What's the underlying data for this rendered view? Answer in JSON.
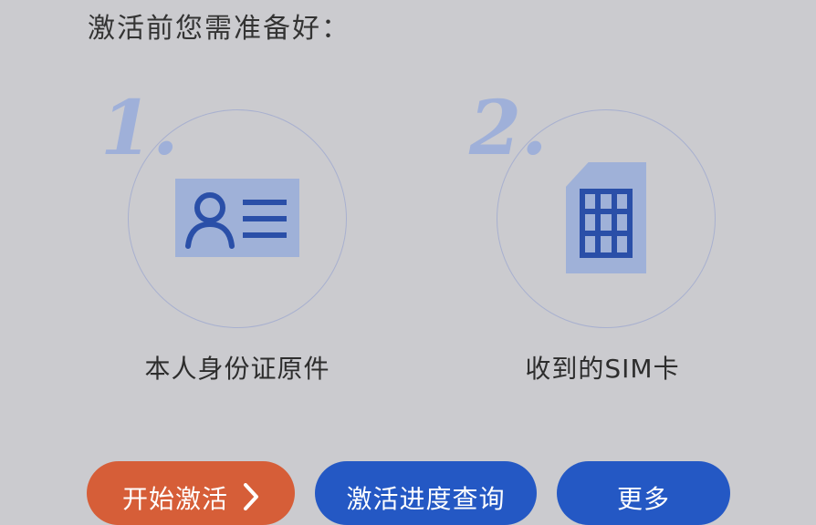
{
  "header": {
    "title": "激活前您需准备好："
  },
  "steps": [
    {
      "number": "1.",
      "label": "本人身份证原件",
      "icon": "id-card-icon"
    },
    {
      "number": "2.",
      "label": "收到的SIM卡",
      "icon": "sim-card-icon"
    }
  ],
  "buttons": {
    "start_label": "开始激活",
    "progress_label": "激活进度查询",
    "more_label": "更多"
  },
  "colors": {
    "background": "#cbcbcf",
    "accent_orange": "#d65e38",
    "accent_blue": "#2458c4",
    "icon_fill": "#9fb1d8",
    "icon_stroke": "#2a4fa8"
  }
}
